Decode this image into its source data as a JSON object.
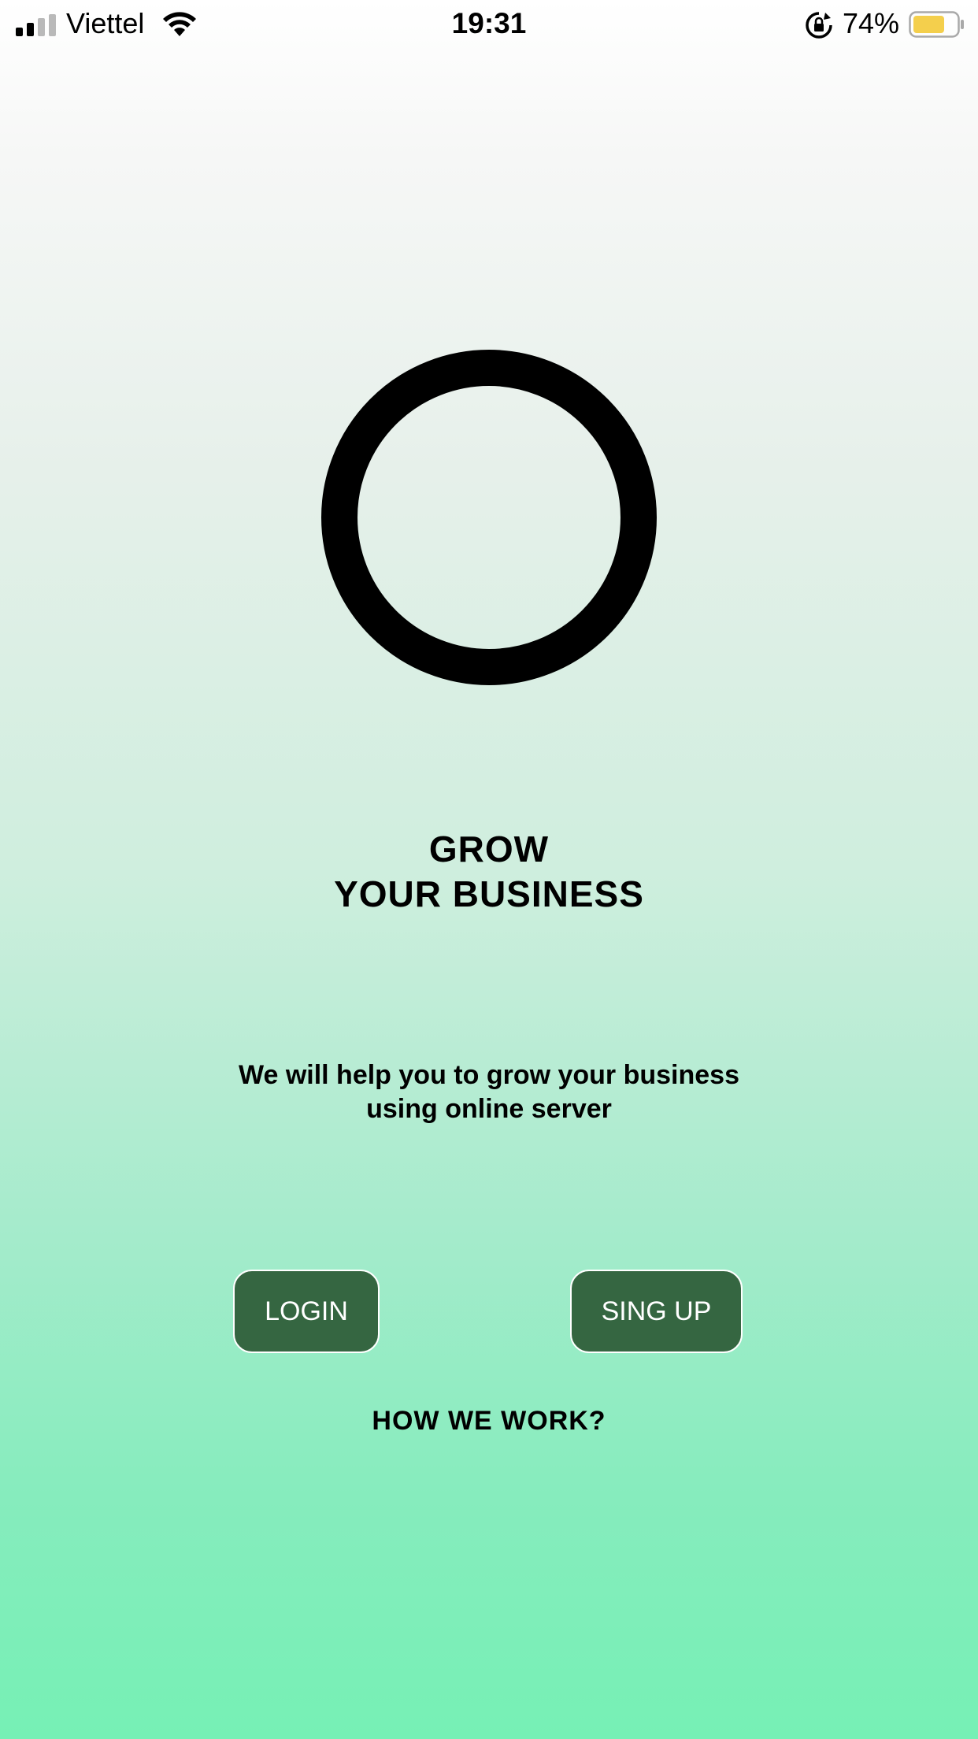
{
  "status_bar": {
    "carrier": "Viettel",
    "time": "19:31",
    "battery_percent": "74%",
    "battery_level": 0.74,
    "battery_color": "#f4cf4c",
    "icons": [
      "signal-icon",
      "wifi-icon",
      "rotation-lock-icon",
      "battery-icon"
    ]
  },
  "hero": {
    "logo": "ring-logo-icon",
    "title_line1": "GROW",
    "title_line2": "YOUR BUSINESS",
    "subtitle_line1": "We will help you to grow your business",
    "subtitle_line2": "using online server"
  },
  "actions": {
    "login_label": "LOGIN",
    "signup_label": "SING UP",
    "how_label": "HOW WE WORK?"
  },
  "colors": {
    "button_bg": "#356641",
    "gradient_top": "#ffffff",
    "gradient_bottom": "#76f0b5"
  }
}
